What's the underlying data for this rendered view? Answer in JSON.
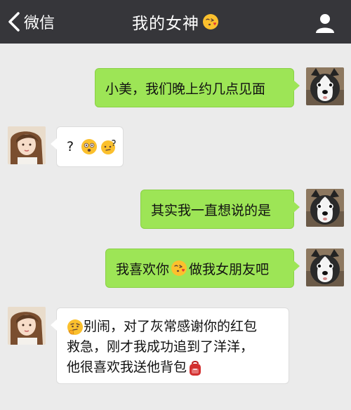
{
  "header": {
    "back_label": "微信",
    "title": "我的女神",
    "title_emoji": "kissing-heart-emoji"
  },
  "messages": [
    {
      "sender": "me",
      "text": "小美，我们晚上约几点见面"
    },
    {
      "sender": "her",
      "text_before": "?",
      "emojis": [
        "confused-face-emoji",
        "thinking-question-emoji"
      ]
    },
    {
      "sender": "me",
      "text": "其实我一直想说的是"
    },
    {
      "sender": "me",
      "text_before": "我喜欢你",
      "emoji": "kissing-heart-emoji",
      "text_after": "做我女朋友吧"
    },
    {
      "sender": "her",
      "lead_emoji": "thinking-face-emoji",
      "line1": "别闹，对了灰常感谢你的红包",
      "line2": "救急，刚才我成功追到了洋洋，",
      "line3": "他很喜欢我送他背包",
      "trail_emoji": "red-backpack-emoji"
    }
  ],
  "colors": {
    "topbar": "#36363a",
    "background": "#ebebeb",
    "sent_bubble": "#9de556",
    "received_bubble": "#ffffff"
  }
}
